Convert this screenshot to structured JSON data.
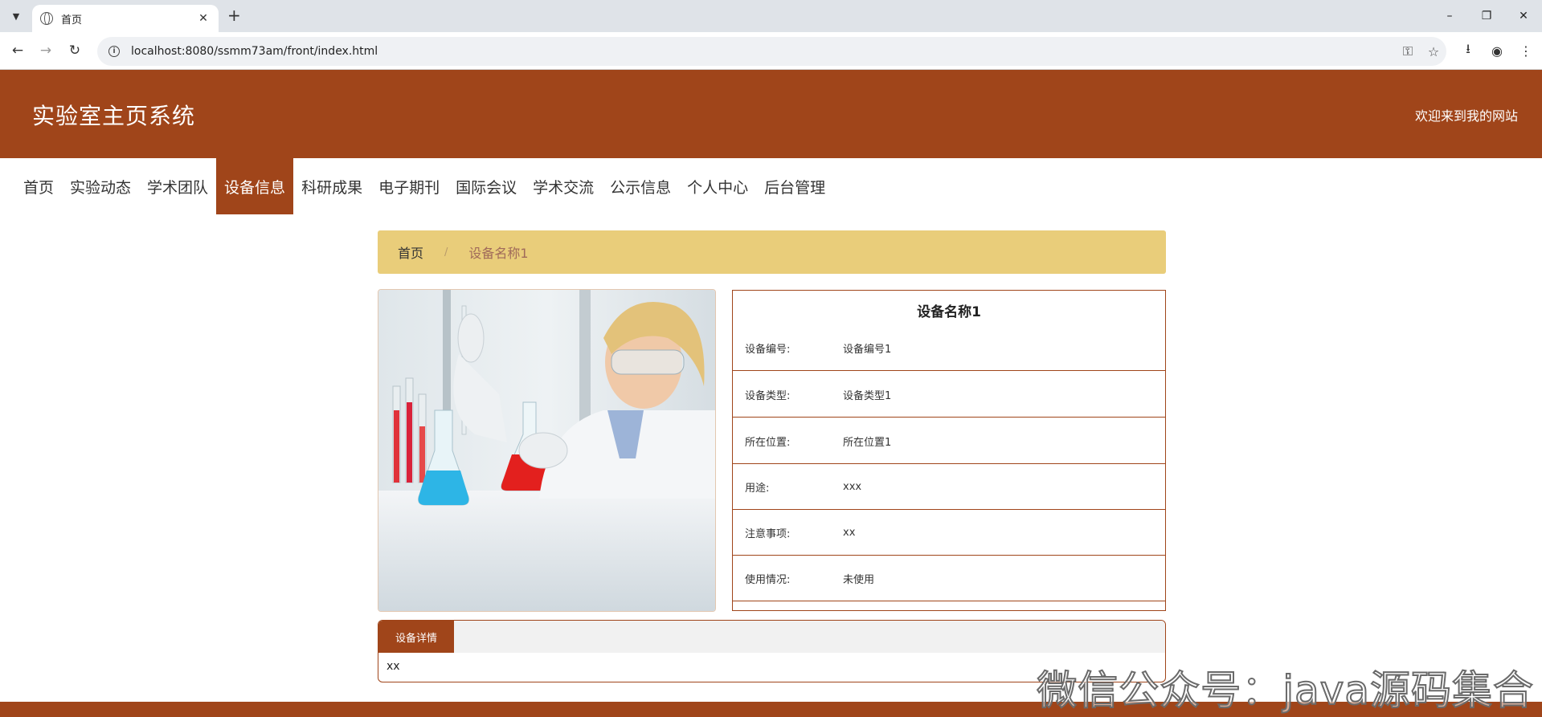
{
  "browser": {
    "tab_title": "首页",
    "url": "localhost:8080/ssmm73am/front/index.html"
  },
  "site": {
    "title": "实验室主页系统",
    "welcome": "欢迎来到我的网站"
  },
  "nav": {
    "items": [
      "首页",
      "实验动态",
      "学术团队",
      "设备信息",
      "科研成果",
      "电子期刊",
      "国际会议",
      "学术交流",
      "公示信息",
      "个人中心",
      "后台管理"
    ],
    "active": "设备信息"
  },
  "breadcrumb": {
    "home": "首页",
    "separator": "/",
    "current": "设备名称1"
  },
  "equipment": {
    "name": "设备名称1",
    "fields": [
      {
        "label": "设备编号:",
        "value": "设备编号1"
      },
      {
        "label": "设备类型:",
        "value": "设备类型1"
      },
      {
        "label": "所在位置:",
        "value": "所在位置1"
      },
      {
        "label": "用途:",
        "value": "xxx"
      },
      {
        "label": "注意事项:",
        "value": "xx"
      },
      {
        "label": "使用情况:",
        "value": "未使用"
      }
    ]
  },
  "detail": {
    "tab_label": "设备详情",
    "content": "xx"
  },
  "watermark": "微信公众号：java源码集合",
  "colors": {
    "brand": "#a0451a",
    "breadcrumb_bg": "#e9cd7a"
  }
}
